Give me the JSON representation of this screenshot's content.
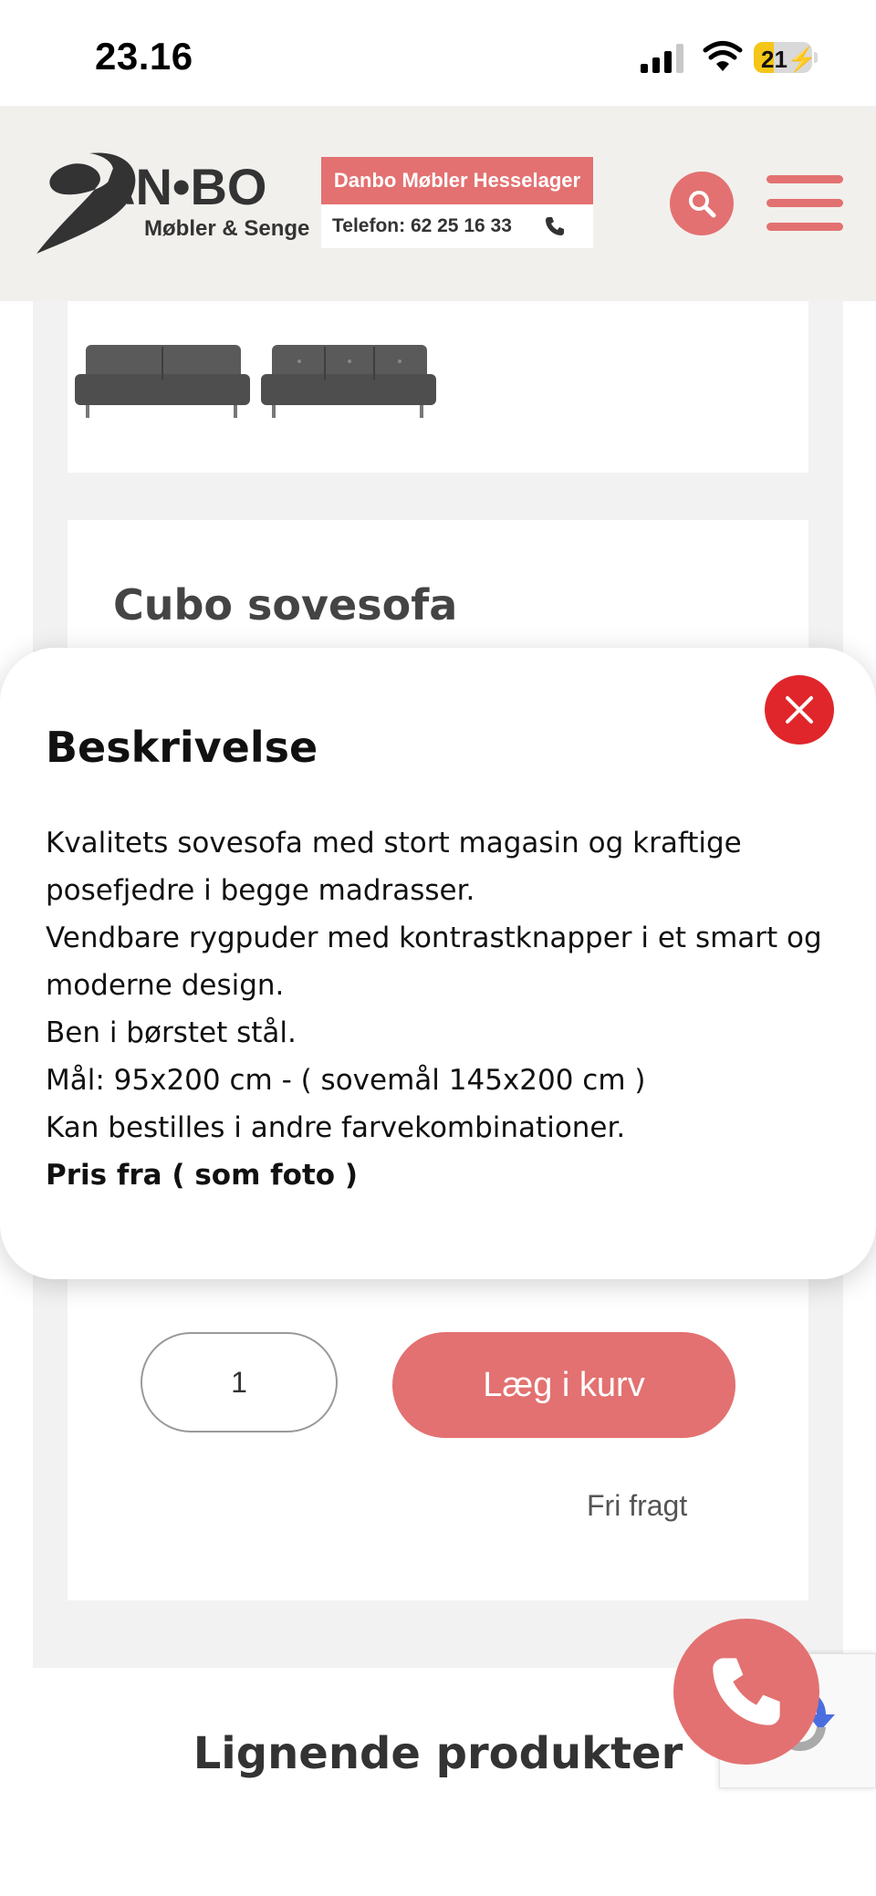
{
  "status_bar": {
    "time": "23.16",
    "battery": "21",
    "signal_icon": "cellular-signal-icon",
    "wifi_icon": "wifi-icon",
    "battery_icon": "battery-charging-icon"
  },
  "header": {
    "logo": {
      "brand": "DAN•BO",
      "tagline": "Møbler & Senge"
    },
    "store_name": "Danbo Møbler Hesselager",
    "store_phone": "Telefon: 62 25 16 33",
    "phone_icon": "phone-icon",
    "search_icon": "search-icon",
    "menu_icon": "hamburger-menu-icon"
  },
  "product": {
    "title": "Cubo sovesofa",
    "thumbnail_count": 2
  },
  "modal": {
    "title": "Beskrivelse",
    "close_icon": "close-icon",
    "lines": [
      "Kvalitets sovesofa med stort magasin og kraftige",
      "posefjedre i begge madrasser.",
      "Vendbare rygpuder med kontrastknapper i et smart og",
      "moderne design.",
      "Ben i børstet stål.",
      "Mål: 95x200 cm - ( sovemål  145x200 cm )",
      "Kan bestilles i andre farvekombinationer."
    ],
    "bold_line": "Pris fra ( som foto )"
  },
  "cart": {
    "quantity": "1",
    "add_to_cart_label": "Læg i kurv",
    "shipping": "Fri fragt"
  },
  "related": {
    "heading": "Lignende produkter"
  },
  "colors": {
    "accent": "#e37171",
    "close_red": "#e0262b",
    "header_bg": "#f2f0ed"
  }
}
